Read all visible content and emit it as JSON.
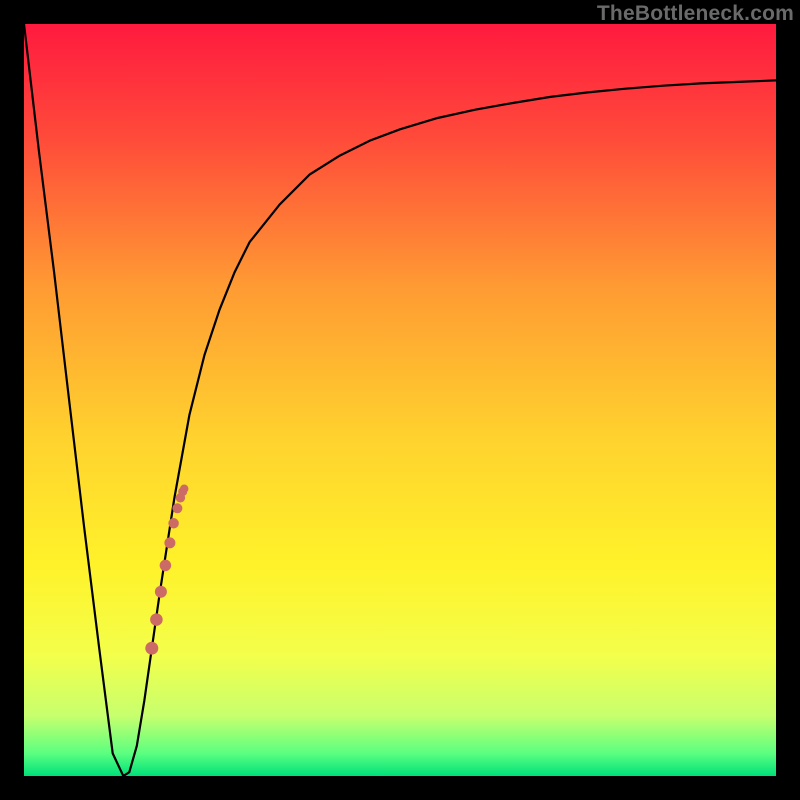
{
  "watermark": "TheBottleneck.com",
  "gradient": {
    "stops": [
      {
        "offset": 0.0,
        "color": "#ff1a3f"
      },
      {
        "offset": 0.15,
        "color": "#ff4a3a"
      },
      {
        "offset": 0.35,
        "color": "#ff9b33"
      },
      {
        "offset": 0.55,
        "color": "#ffd22e"
      },
      {
        "offset": 0.72,
        "color": "#fff22a"
      },
      {
        "offset": 0.84,
        "color": "#f3ff4b"
      },
      {
        "offset": 0.92,
        "color": "#c7ff6e"
      },
      {
        "offset": 0.97,
        "color": "#5bff80"
      },
      {
        "offset": 1.0,
        "color": "#00e07a"
      }
    ]
  },
  "chart_data": {
    "type": "line",
    "title": "",
    "xlabel": "",
    "ylabel": "",
    "xlim": [
      0,
      100
    ],
    "ylim": [
      0,
      100
    ],
    "series": [
      {
        "name": "curve",
        "x": [
          0,
          2,
          4,
          6,
          8,
          10,
          11.8,
          13.2,
          14,
          15,
          16,
          18,
          20,
          22,
          24,
          26,
          28,
          30,
          34,
          38,
          42,
          46,
          50,
          55,
          60,
          65,
          70,
          75,
          80,
          85,
          90,
          95,
          100
        ],
        "y": [
          100,
          83,
          67,
          50,
          33,
          17,
          3,
          0,
          0.5,
          4,
          10,
          24,
          37,
          48,
          56,
          62,
          67,
          71,
          76,
          80,
          82.5,
          84.5,
          86,
          87.5,
          88.6,
          89.5,
          90.3,
          90.9,
          91.4,
          91.8,
          92.1,
          92.3,
          92.5
        ]
      },
      {
        "name": "markers",
        "x": [
          17,
          17.6,
          18.2,
          18.8,
          19.4,
          19.9,
          20.4,
          20.8,
          21.1,
          21.3
        ],
        "y": [
          17,
          20.8,
          24.5,
          28,
          31,
          33.6,
          35.6,
          37,
          37.8,
          38.2
        ]
      }
    ]
  },
  "colors": {
    "curve_stroke": "#000000",
    "marker_fill": "#cc6b66"
  }
}
